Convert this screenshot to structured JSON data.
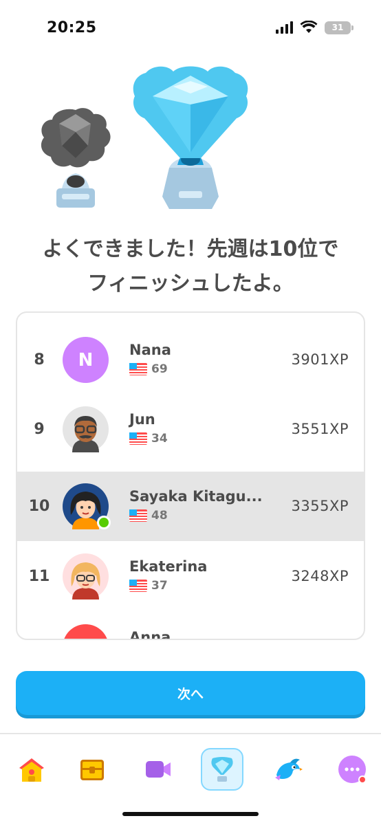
{
  "status_bar": {
    "time": "20:25",
    "battery": "31"
  },
  "headline": {
    "line1": "よくできました！先週は10位で",
    "line2": "フィニッシュしたよ。"
  },
  "leaderboard": {
    "rows": [
      {
        "rank": "",
        "name": "",
        "streak": "",
        "xp": ""
      },
      {
        "rank": "8",
        "name": "Nana",
        "streak": "69",
        "xp": "3901XP",
        "avatar_letter": "N"
      },
      {
        "rank": "9",
        "name": "Jun",
        "streak": "34",
        "xp": "3551XP"
      },
      {
        "rank": "10",
        "name": "Sayaka Kitagu...",
        "streak": "48",
        "xp": "3355XP",
        "highlight": true
      },
      {
        "rank": "11",
        "name": "Ekaterina",
        "streak": "37",
        "xp": "3248XP"
      },
      {
        "rank": "",
        "name": "Anna",
        "streak": "",
        "xp": ""
      }
    ]
  },
  "next_button": {
    "label": "次へ"
  },
  "tabs": [
    {
      "icon": "home-icon"
    },
    {
      "icon": "treasure-chest-icon"
    },
    {
      "icon": "video-camera-icon"
    },
    {
      "icon": "league-trophy-icon",
      "active": true
    },
    {
      "icon": "bird-mascot-icon"
    },
    {
      "icon": "more-icon",
      "badge": true
    }
  ],
  "colors": {
    "accent": "#1cb0f6",
    "highlight_row": "#e5e5e5",
    "online": "#58cc02",
    "notification": "#ff4b4b"
  }
}
